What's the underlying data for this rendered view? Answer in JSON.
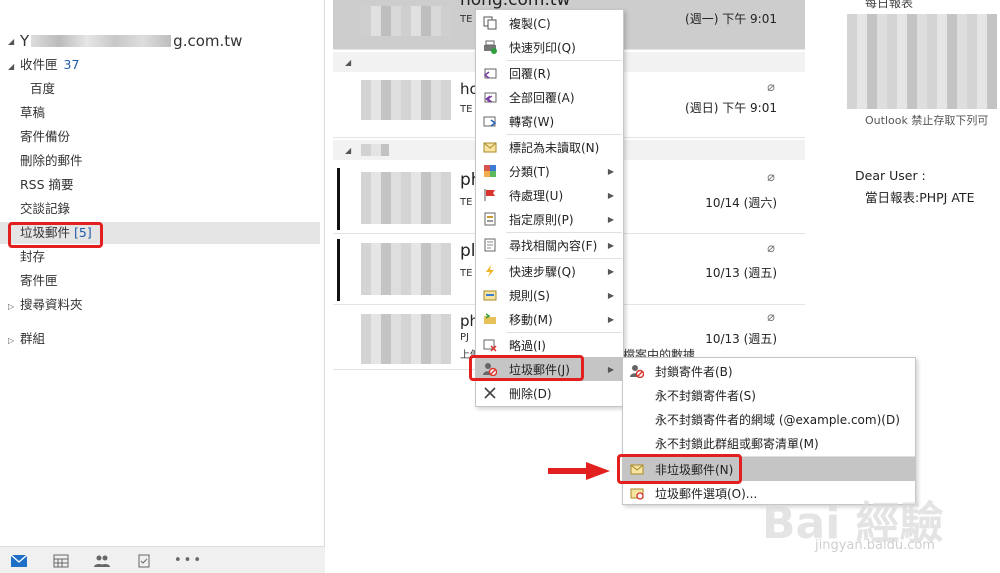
{
  "folders": {
    "account_prefix": "Y",
    "account_suffix": "g.com.tw",
    "inbox": "收件匣",
    "inbox_count": "37",
    "baidu": "百度",
    "drafts": "草稿",
    "sent": "寄件備份",
    "deleted": "刪除的郵件",
    "rss": "RSS 摘要",
    "conversation": "交談記錄",
    "junk": "垃圾郵件",
    "junk_count": "[5]",
    "archive": "封存",
    "outbox": "寄件匣",
    "search_folders": "搜尋資料夾",
    "groups": "群組"
  },
  "messages": [
    {
      "from": "hong.com.tw",
      "subject": "TE 報",
      "date": "(週一) 下午 9:01"
    },
    {
      "from": "ho",
      "subject": "TE 報",
      "date": "(週日) 下午 9:01"
    },
    {
      "from": "ph",
      "subject": "TE 報",
      "date": "10/14 (週六)"
    },
    {
      "from": "pl",
      "subject": "TE 報",
      "date": "10/13 (週五)"
    },
    {
      "from": "ph",
      "subject": "PJ",
      "preview": "上傳",
      "preview2": "檔案中的數據",
      "date": "10/13 (週五)"
    }
  ],
  "reading": {
    "top": "每日報表",
    "note": "Outlook 禁止存取下列可",
    "dear": "Dear User :",
    "body": "當日報表:PHPJ ATE"
  },
  "context_menu": {
    "copy": "複製(C)",
    "quick_print": "快速列印(Q)",
    "reply": "回覆(R)",
    "reply_all": "全部回覆(A)",
    "forward": "轉寄(W)",
    "mark_unread": "標記為未讀取(N)",
    "categorize": "分類(T)",
    "follow_up": "待處理(U)",
    "assign_policy": "指定原則(P)",
    "find_related": "尋找相關內容(F)",
    "quick_steps": "快速步驟(Q)",
    "rules": "規則(S)",
    "move": "移動(M)",
    "ignore": "略過(I)",
    "junk": "垃圾郵件(J)",
    "delete": "刪除(D)"
  },
  "junk_submenu": {
    "block_sender": "封鎖寄件者(B)",
    "never_block_sender": "永不封鎖寄件者(S)",
    "never_block_domain": "永不封鎖寄件者的網域 (@example.com)(D)",
    "never_block_group": "永不封鎖此群組或郵寄清單(M)",
    "not_junk": "非垃圾郵件(N)",
    "junk_options": "垃圾郵件選項(O)..."
  },
  "watermark": {
    "brand": "Bai 經驗",
    "url": "jingyan.baidu.com"
  },
  "colors": {
    "highlight_red": "#e32020",
    "count_blue": "#1f5ba8"
  }
}
